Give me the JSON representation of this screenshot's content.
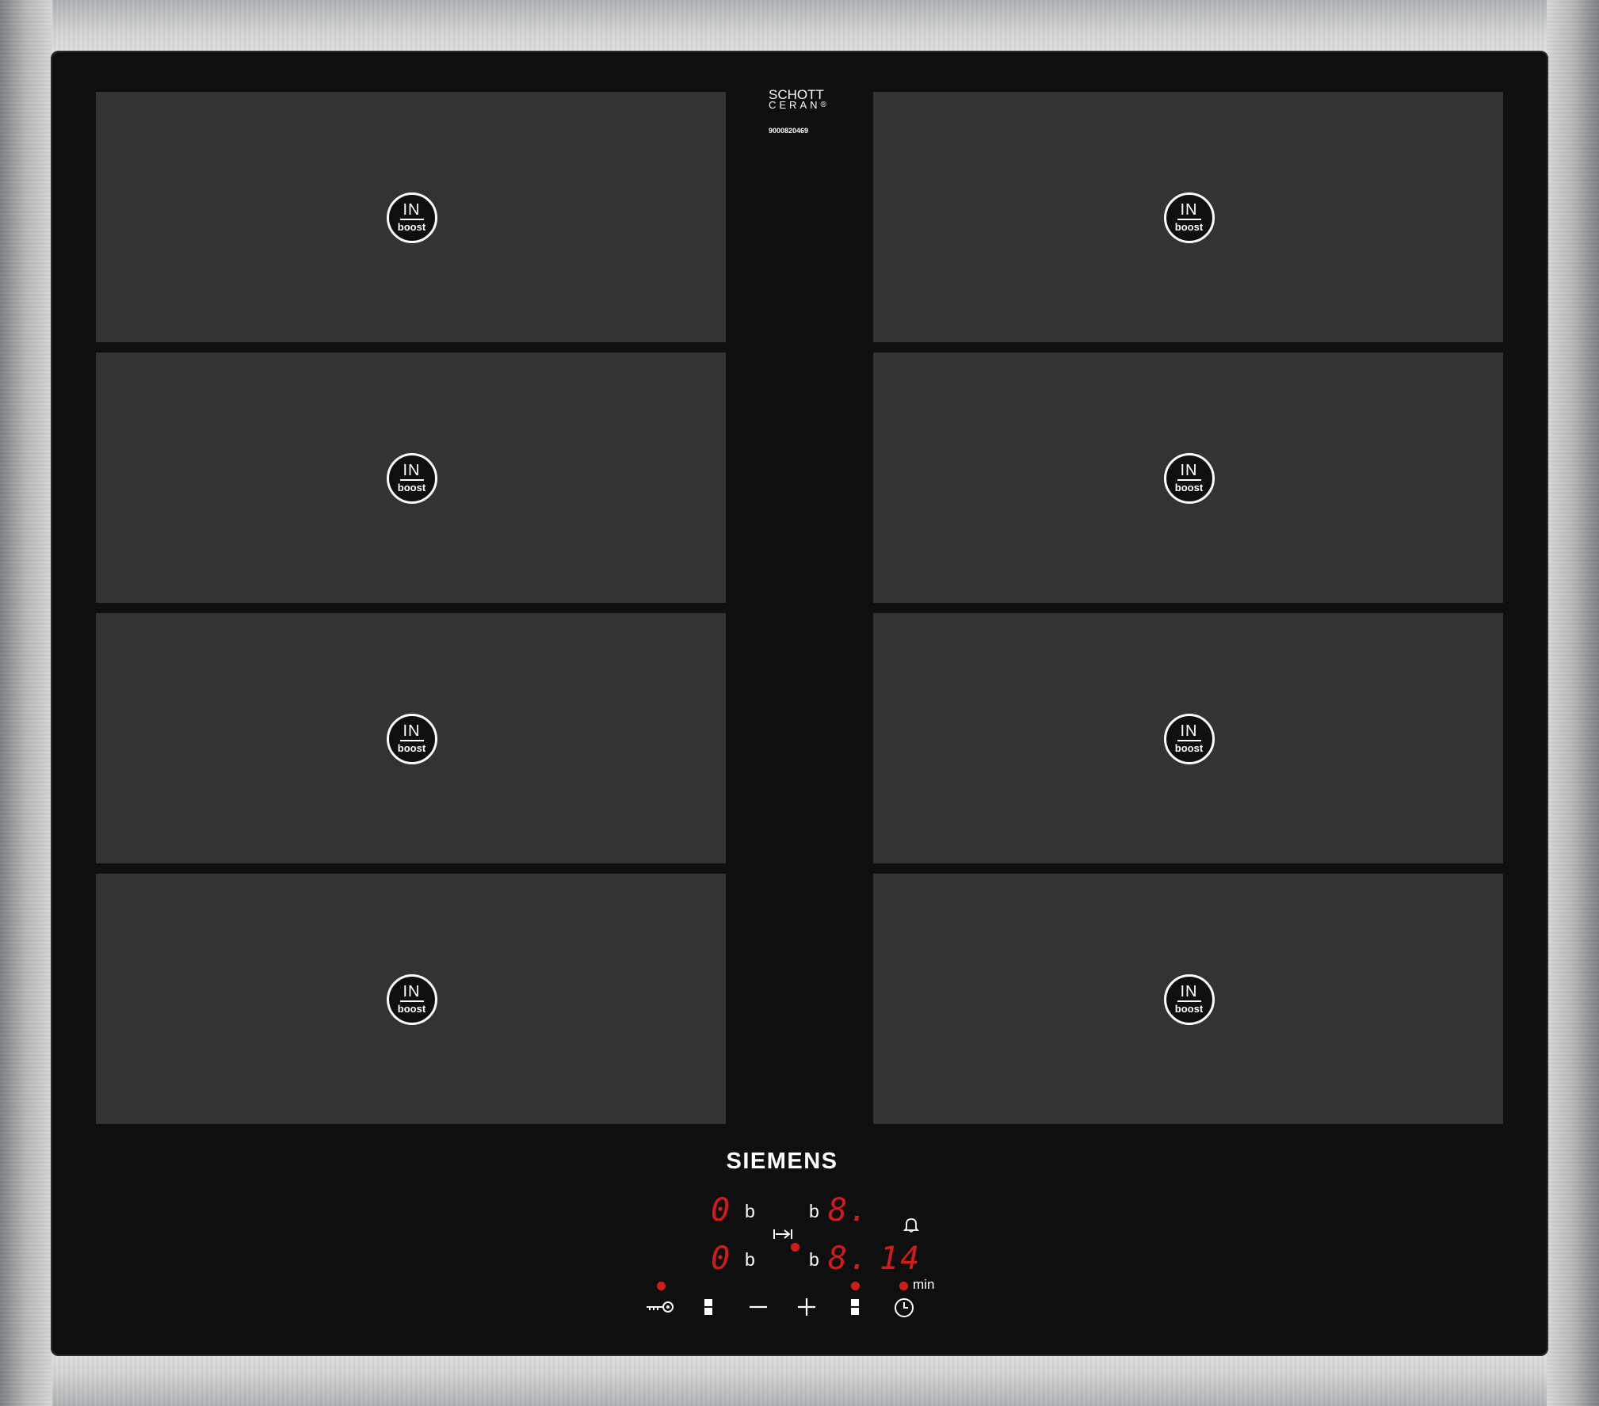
{
  "glass": {
    "logo_line1": "SCHOTT",
    "logo_line2": "CERAN",
    "logo_reg": "®",
    "serial": "9000820469"
  },
  "zones": [
    {
      "label_top": "IN",
      "label_bottom": "boost"
    },
    {
      "label_top": "IN",
      "label_bottom": "boost"
    },
    {
      "label_top": "IN",
      "label_bottom": "boost"
    },
    {
      "label_top": "IN",
      "label_bottom": "boost"
    },
    {
      "label_top": "IN",
      "label_bottom": "boost"
    },
    {
      "label_top": "IN",
      "label_bottom": "boost"
    },
    {
      "label_top": "IN",
      "label_bottom": "boost"
    },
    {
      "label_top": "IN",
      "label_bottom": "boost"
    }
  ],
  "brand": "SIEMENS",
  "display": {
    "left_top_value": "0",
    "left_bottom_value": "0",
    "right_top_value": "8.",
    "right_bottom_value": "8.",
    "timer_value": "14",
    "booster_marker": "b",
    "timer_unit": "min",
    "indicator_color": "#d21c1c"
  },
  "controls": {
    "icons": [
      "key-lock-icon",
      "zone-select-left-icon",
      "minus-icon",
      "plus-icon",
      "zone-select-right-icon",
      "clock-icon",
      "bell-icon",
      "flex-zone-icon"
    ]
  }
}
